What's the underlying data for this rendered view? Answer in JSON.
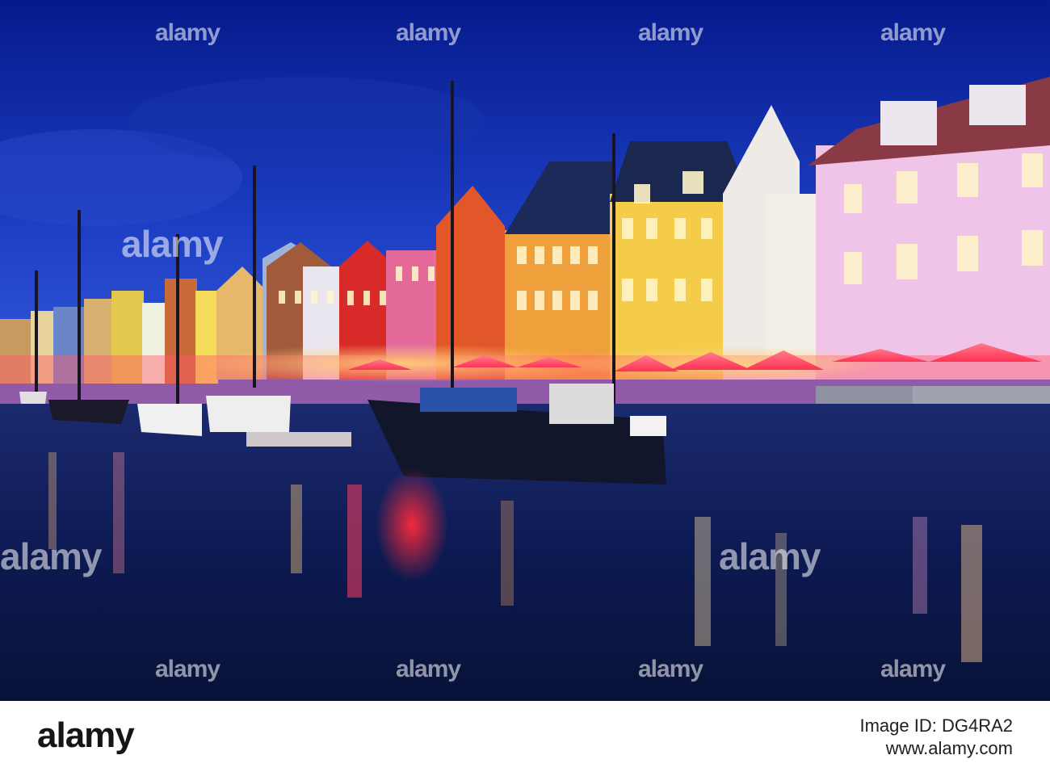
{
  "photo": {
    "colors": {
      "sky_top": "#061a8c",
      "sky_bottom": "#2c52d6",
      "water": "#0b1a4a",
      "warm_light": "#ffd27a",
      "red_light": "#ff2a3a"
    }
  },
  "watermarks": {
    "brand": "alamy"
  },
  "footer": {
    "logo": "alamy",
    "image_id": "Image ID: DG4RA2",
    "url": "www.alamy.com"
  }
}
